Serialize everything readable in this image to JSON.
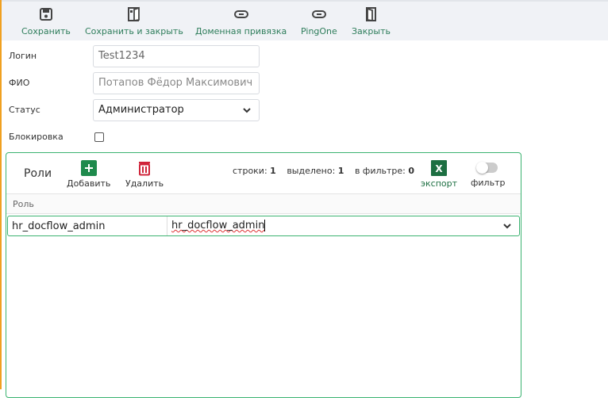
{
  "toolbar": {
    "items": [
      {
        "label": "Сохранить",
        "icon": "save-icon"
      },
      {
        "label": "Сохранить и закрыть",
        "icon": "save-close-icon"
      },
      {
        "label": "Доменная привязка",
        "icon": "link-icon"
      },
      {
        "label": "PingOne",
        "icon": "link-icon"
      },
      {
        "label": "Закрыть",
        "icon": "door-icon"
      }
    ]
  },
  "form": {
    "login_label": "Логин",
    "login_value": "Test1234",
    "fio_label": "ФИО",
    "fio_placeholder": "Потапов Фёдор Максимович",
    "status_label": "Статус",
    "status_value": "Администратор",
    "block_label": "Блокировка",
    "block_checked": false
  },
  "roles": {
    "title": "Роли",
    "add_label": "Добавить",
    "delete_label": "Удалить",
    "rows_label": "строки:",
    "rows_value": "1",
    "selected_label": "выделено:",
    "selected_value": "1",
    "filtered_label": "в фильтре:",
    "filtered_value": "0",
    "export_label": "экспорт",
    "filter_label": "фильтр",
    "filter_on": false,
    "column": "Роль",
    "rows": [
      {
        "role": "hr_docflow_admin",
        "edit_value": "hr_docflow_admin"
      }
    ]
  },
  "colors": {
    "accent": "#2e7d5b",
    "add": "#1e8a4c",
    "delete": "#d0243a",
    "excel": "#1d6f42"
  }
}
